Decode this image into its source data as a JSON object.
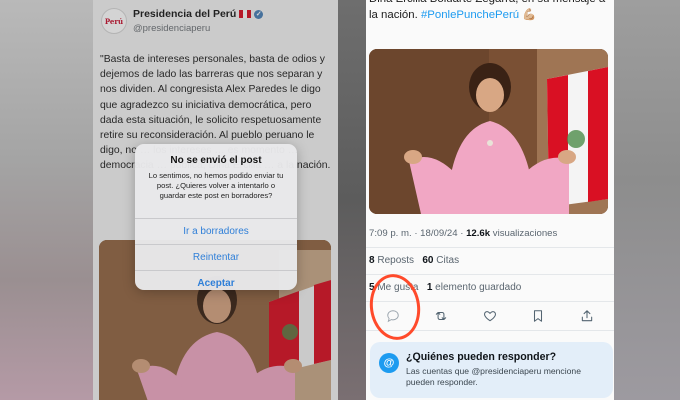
{
  "left_post": {
    "account_name": "Presidencia del Perú",
    "handle": "@presidenciaperu",
    "avatar_label": "Perú",
    "text": "\"Basta de intereses personales, basta de odios y dejemos de lado las barreras que nos separan y nos dividen. Al congresista Alex Paredes le digo que agradezco su iniciativa democrática, pero dada esta situación, le solicito respetuosamente retire su reconsideración. Al pueblo peruano le digo, no … los intereses … es momento … democracia … pública, Dina Ercilia … a la nación."
  },
  "dialog": {
    "title": "No se envió el post",
    "message": "Lo sentimos, no hemos podido enviar tu post. ¿Quieres volver a intentarlo o guardar este post en borradores?",
    "buttons": [
      "Ir a borradores",
      "Reintentar",
      "Aceptar"
    ]
  },
  "right_post": {
    "text_before": "Dina Ercilia Boluarte Zegarra, en su mensaje a la nación.",
    "hashtag": "#PonlePunchePerú",
    "timestamp": "7:09 p. m. · 18/09/24 ·",
    "views_count": "12.6k",
    "views_label": "visualizaciones",
    "reposts_count": "8",
    "reposts_label": "Reposts",
    "quotes_count": "60",
    "quotes_label": "Citas",
    "likes_count": "5",
    "likes_label": "Me gusta",
    "bookmarks_count": "1",
    "bookmarks_label": "elemento guardado",
    "reply_title": "¿Quiénes pueden responder?",
    "reply_desc": "Las cuentas que @presidenciaperu mencione pueden responder."
  },
  "colors": {
    "accent": "#1d9bf0",
    "dialog_action": "#2f7fd8",
    "annotation_circle": "#ff4a2b",
    "flag_red": "#d91023"
  }
}
